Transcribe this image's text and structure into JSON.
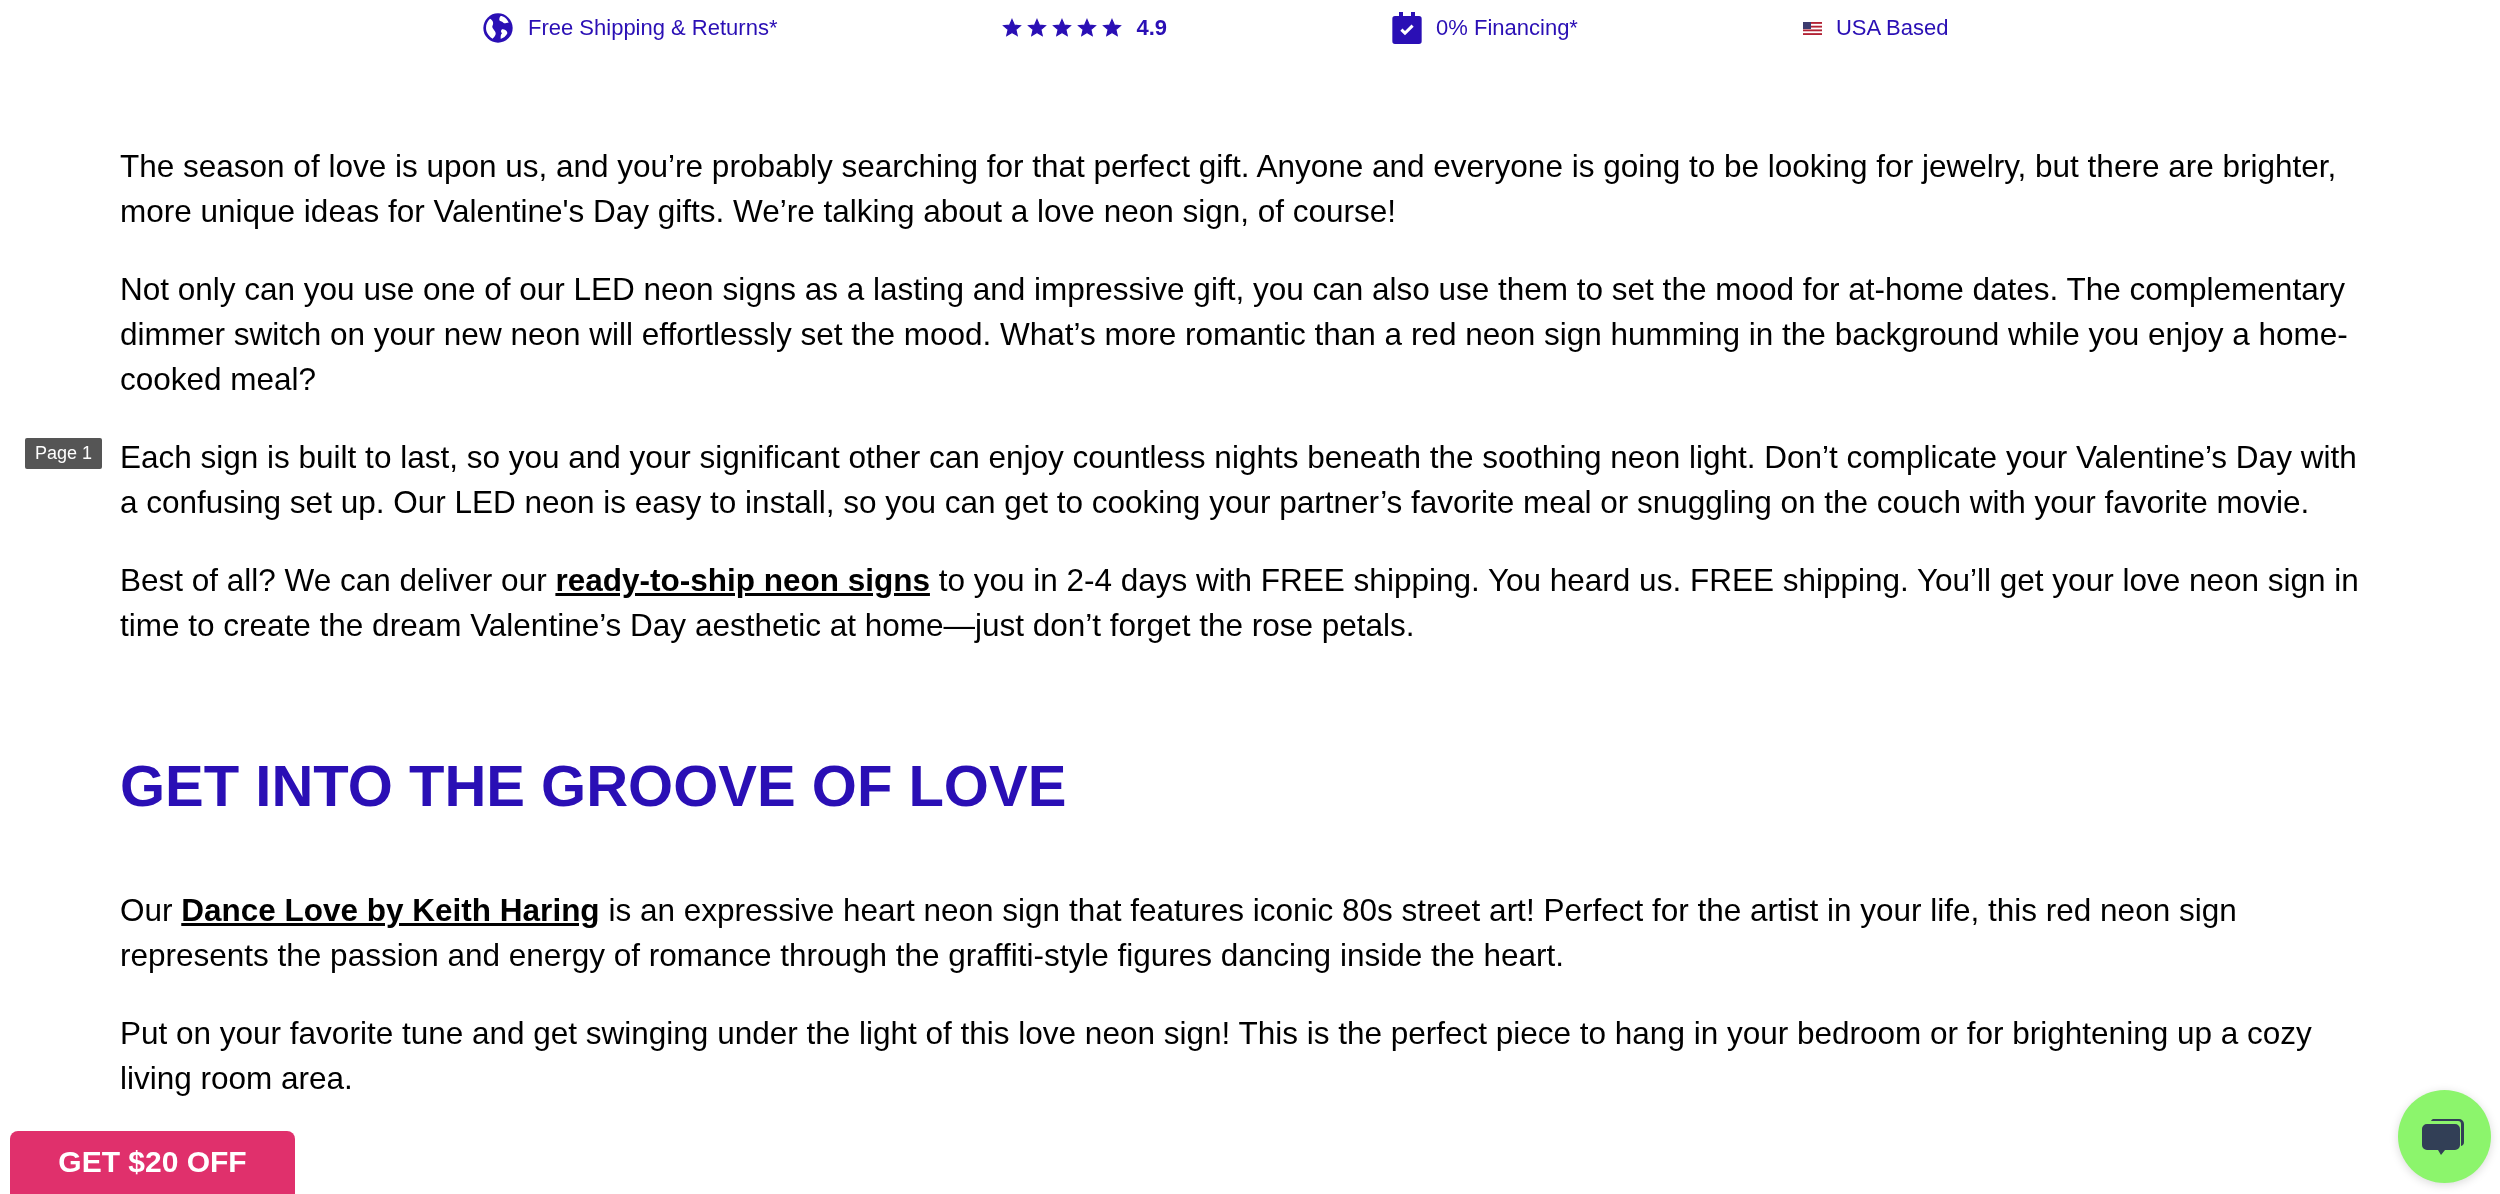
{
  "top_bar": [
    {
      "kind": "shipping",
      "text": "Free Shipping & Returns*"
    },
    {
      "kind": "rating",
      "stars": 5,
      "text": "4.9"
    },
    {
      "kind": "financing",
      "text": "0% Financing*"
    },
    {
      "kind": "flag",
      "text": "USA Based"
    }
  ],
  "page_label": "Page 1",
  "intro": [
    [
      {
        "text": "The season of love is upon us, and you’re probably searching for that perfect gift. Anyone and everyone is going to be looking for jewelry, but there are brighter, more unique ideas for Valentine's Day gifts. We’re talking about a love neon sign, of course!",
        "link": false
      }
    ],
    [
      {
        "text": "Not only can you use one of our LED neon signs as a lasting and impressive gift, you can also use them to set the mood for at-home dates. The complementary dimmer switch on your new neon will effortlessly set the mood. What’s more romantic than a red neon sign humming in the background while you enjoy a home-cooked meal?",
        "link": false
      }
    ],
    [
      {
        "text": "Each sign is built to last, so you and your significant other can enjoy countless nights beneath the soothing neon light. Don’t complicate your Valentine’s Day with a confusing set up. Our LED neon is easy to install, so you can get to cooking your partner’s favorite meal or snuggling on the couch with your favorite movie.",
        "link": false
      }
    ],
    [
      {
        "text": "Best of all? We can deliver our ",
        "link": false
      },
      {
        "text": "ready-to-ship neon signs",
        "link": true
      },
      {
        "text": " to you in 2-4 days with FREE shipping. You heard us. FREE shipping. You’ll get your love neon sign in time to create the dream Valentine’s Day aesthetic at home—just don’t forget the rose petals.",
        "link": false
      }
    ]
  ],
  "heading": "GET INTO THE GROOVE OF LOVE",
  "section": [
    [
      {
        "text": "Our ",
        "link": false
      },
      {
        "text": "Dance Love by Keith Haring",
        "link": true
      },
      {
        "text": " is an expressive heart neon sign that features iconic 80s street art! Perfect for the artist in your life, this red neon sign represents the passion and energy of romance through the graffiti-style figures dancing inside the heart.",
        "link": false
      }
    ],
    [
      {
        "text": "Put on your favorite tune and get swinging under the light of this love neon sign! This is the perfect piece to hang in your bedroom or for brightening up a cozy living room area.",
        "link": false
      }
    ]
  ],
  "promo_button": "GET $20 OFF",
  "chat_button": {
    "kind": "chat"
  }
}
